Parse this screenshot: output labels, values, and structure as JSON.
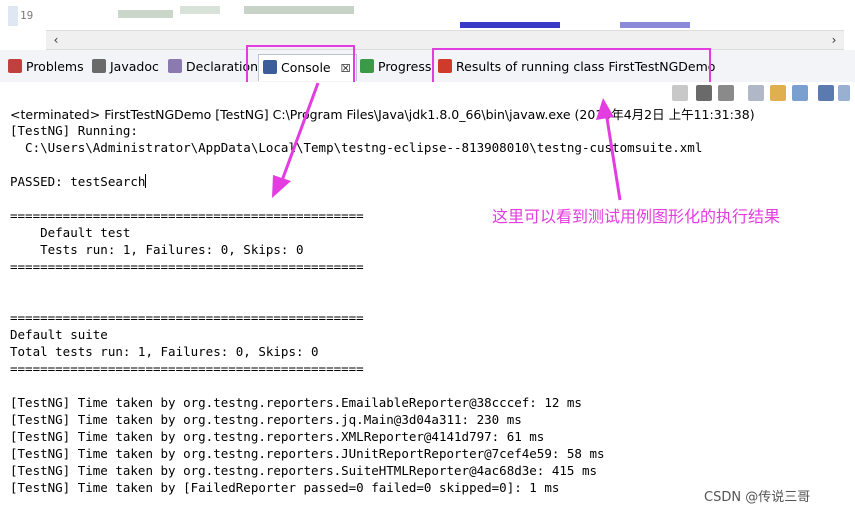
{
  "editor": {
    "line_number": "19"
  },
  "tabs": [
    {
      "label": "Problems",
      "icon": "problems-icon"
    },
    {
      "label": "Javadoc",
      "icon": "javadoc-icon"
    },
    {
      "label": "Declaration",
      "icon": "declaration-icon"
    },
    {
      "label": "Console",
      "icon": "console-icon",
      "close": "☒"
    },
    {
      "label": "Progress",
      "icon": "progress-icon"
    },
    {
      "label": "Results of running class FirstTestNGDemo",
      "icon": "testng-icon"
    }
  ],
  "status_line": "<terminated> FirstTestNGDemo [TestNG] C:\\Program Files\\Java\\jdk1.8.0_66\\bin\\javaw.exe (2016年4月2日 上午11:31:38)",
  "console_lines": [
    "[TestNG] Running:",
    "  C:\\Users\\Administrator\\AppData\\Local\\Temp\\testng-eclipse--813908010\\testng-customsuite.xml",
    "",
    "PASSED: testSearch",
    "",
    "===============================================",
    "    Default test",
    "    Tests run: 1, Failures: 0, Skips: 0",
    "===============================================",
    "",
    "",
    "===============================================",
    "Default suite",
    "Total tests run: 1, Failures: 0, Skips: 0",
    "===============================================",
    "",
    "[TestNG] Time taken by org.testng.reporters.EmailableReporter@38cccef: 12 ms",
    "[TestNG] Time taken by org.testng.reporters.jq.Main@3d04a311: 230 ms",
    "[TestNG] Time taken by org.testng.reporters.XMLReporter@4141d797: 61 ms",
    "[TestNG] Time taken by org.testng.reporters.JUnitReportReporter@7cef4e59: 58 ms",
    "[TestNG] Time taken by org.testng.reporters.SuiteHTMLReporter@4ac68d3e: 415 ms",
    "[TestNG] Time taken by [FailedReporter passed=0 failed=0 skipped=0]: 1 ms"
  ],
  "annotation": "这里可以看到测试用例图形化的执行结果",
  "watermark": "CSDN @传说三哥",
  "colors": {
    "highlight": "#e33ce0",
    "tab_border": "#b8c4d6"
  }
}
